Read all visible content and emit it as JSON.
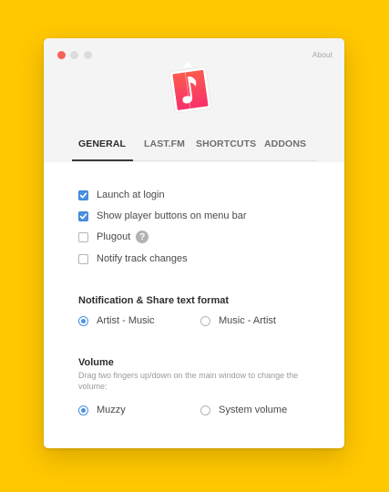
{
  "window": {
    "about_label": "About"
  },
  "tabs": [
    {
      "label": "GENERAL",
      "active": true
    },
    {
      "label": "LAST.FM",
      "active": false
    },
    {
      "label": "SHORTCUTS",
      "active": false
    },
    {
      "label": "ADDONS",
      "active": false
    }
  ],
  "general": {
    "options": [
      {
        "label": "Launch at login",
        "checked": true
      },
      {
        "label": "Show player buttons on menu bar",
        "checked": true
      },
      {
        "label": "Plugout",
        "checked": false,
        "help": "?"
      },
      {
        "label": "Notify track changes",
        "checked": false
      }
    ],
    "share_format": {
      "title": "Notification & Share text format",
      "choices": [
        {
          "label": "Artist - Music",
          "selected": true
        },
        {
          "label": "Music - Artist",
          "selected": false
        }
      ]
    },
    "volume": {
      "title": "Volume",
      "description": "Drag two fingers up/down on the main window to change the volume:",
      "choices": [
        {
          "label": "Muzzy",
          "selected": true
        },
        {
          "label": "System volume",
          "selected": false
        }
      ]
    }
  },
  "colors": {
    "background": "#FFC800",
    "accent": "#4A90E2",
    "close_button": "#FC605B",
    "app_icon_red": "#FB3A55"
  },
  "icons": {
    "app": "music-note-app-icon",
    "help": "question-mark-icon"
  }
}
